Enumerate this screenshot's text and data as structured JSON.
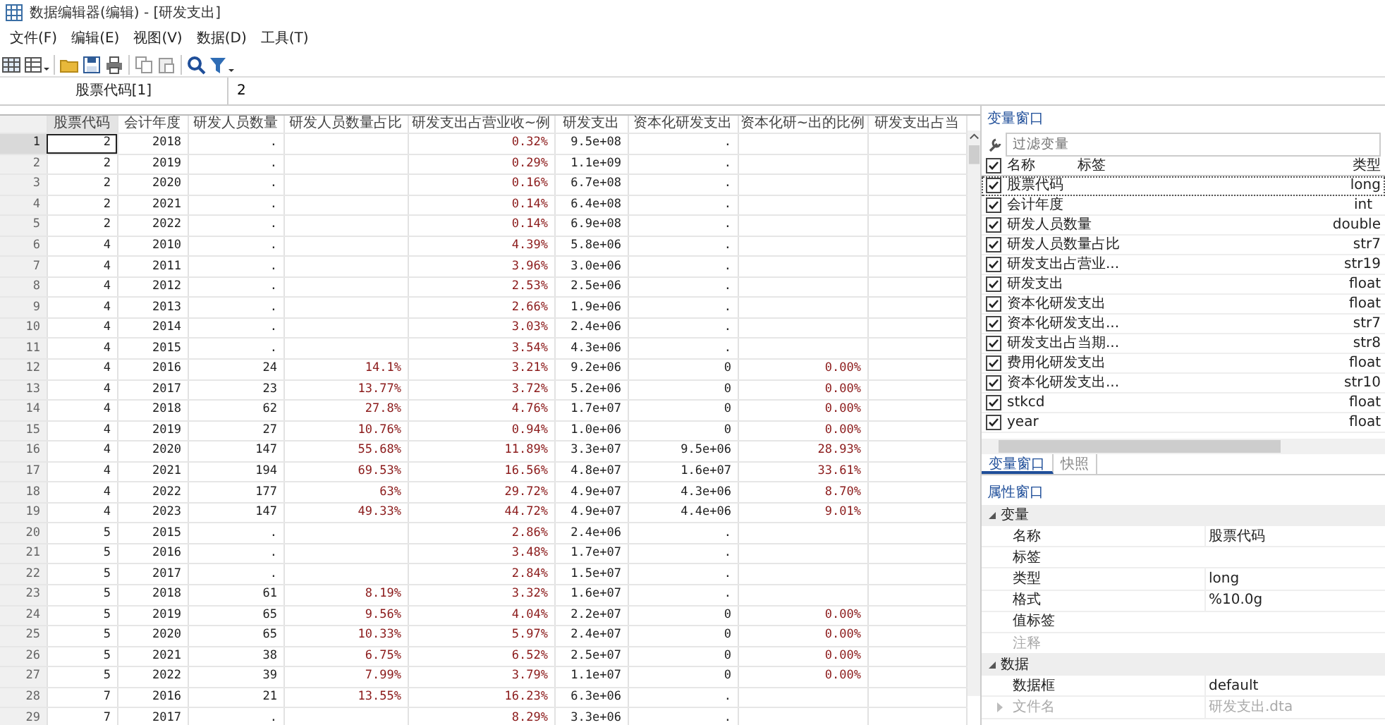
{
  "window": {
    "title": "数据编辑器(编辑) - [研发支出]"
  },
  "menu": [
    "文件(F)",
    "编辑(E)",
    "视图(V)",
    "数据(D)",
    "工具(T)"
  ],
  "cell_bar": {
    "reference": "股票代码[1]",
    "value": "2"
  },
  "table": {
    "columns": [
      {
        "label": "股票代码",
        "kind": "numeric",
        "selected": true
      },
      {
        "label": "会计年度",
        "kind": "numeric",
        "selected": false
      },
      {
        "label": "研发人员数量",
        "kind": "numeric",
        "selected": false
      },
      {
        "label": "研发人员数量占比",
        "kind": "string",
        "selected": false
      },
      {
        "label": "研发支出占营业收~例",
        "kind": "string",
        "selected": false
      },
      {
        "label": "研发支出",
        "kind": "numeric",
        "selected": false
      },
      {
        "label": "资本化研发支出",
        "kind": "numeric",
        "selected": false
      },
      {
        "label": "资本化研~出的比例",
        "kind": "string",
        "selected": false
      },
      {
        "label": "研发支出占当",
        "kind": "string",
        "selected": false
      }
    ],
    "rows": [
      {
        "number": "1",
        "selected": true,
        "cells": [
          "2",
          "2018",
          ".",
          null,
          "0.32%",
          "9.5e+08",
          ".",
          null,
          null
        ]
      },
      {
        "number": "2",
        "selected": false,
        "cells": [
          "2",
          "2019",
          ".",
          null,
          "0.29%",
          "1.1e+09",
          ".",
          null,
          null
        ]
      },
      {
        "number": "3",
        "selected": false,
        "cells": [
          "2",
          "2020",
          ".",
          null,
          "0.16%",
          "6.7e+08",
          ".",
          null,
          null
        ]
      },
      {
        "number": "4",
        "selected": false,
        "cells": [
          "2",
          "2021",
          ".",
          null,
          "0.14%",
          "6.4e+08",
          ".",
          null,
          null
        ]
      },
      {
        "number": "5",
        "selected": false,
        "cells": [
          "2",
          "2022",
          ".",
          null,
          "0.14%",
          "6.9e+08",
          ".",
          null,
          null
        ]
      },
      {
        "number": "6",
        "selected": false,
        "cells": [
          "4",
          "2010",
          ".",
          null,
          "4.39%",
          "5.8e+06",
          ".",
          null,
          null
        ]
      },
      {
        "number": "7",
        "selected": false,
        "cells": [
          "4",
          "2011",
          ".",
          null,
          "3.96%",
          "3.0e+06",
          ".",
          null,
          null
        ]
      },
      {
        "number": "8",
        "selected": false,
        "cells": [
          "4",
          "2012",
          ".",
          null,
          "2.53%",
          "2.5e+06",
          ".",
          null,
          null
        ]
      },
      {
        "number": "9",
        "selected": false,
        "cells": [
          "4",
          "2013",
          ".",
          null,
          "2.66%",
          "1.9e+06",
          ".",
          null,
          null
        ]
      },
      {
        "number": "10",
        "selected": false,
        "cells": [
          "4",
          "2014",
          ".",
          null,
          "3.03%",
          "2.4e+06",
          ".",
          null,
          null
        ]
      },
      {
        "number": "11",
        "selected": false,
        "cells": [
          "4",
          "2015",
          ".",
          null,
          "3.54%",
          "4.3e+06",
          ".",
          null,
          null
        ]
      },
      {
        "number": "12",
        "selected": false,
        "cells": [
          "4",
          "2016",
          "24",
          "14.1%",
          "3.21%",
          "9.2e+06",
          "0",
          "0.00%",
          null
        ]
      },
      {
        "number": "13",
        "selected": false,
        "cells": [
          "4",
          "2017",
          "23",
          "13.77%",
          "3.72%",
          "5.2e+06",
          "0",
          "0.00%",
          null
        ]
      },
      {
        "number": "14",
        "selected": false,
        "cells": [
          "4",
          "2018",
          "62",
          "27.8%",
          "4.76%",
          "1.7e+07",
          "0",
          "0.00%",
          null
        ]
      },
      {
        "number": "15",
        "selected": false,
        "cells": [
          "4",
          "2019",
          "27",
          "10.76%",
          "0.94%",
          "1.0e+06",
          "0",
          "0.00%",
          null
        ]
      },
      {
        "number": "16",
        "selected": false,
        "cells": [
          "4",
          "2020",
          "147",
          "55.68%",
          "11.89%",
          "3.3e+07",
          "9.5e+06",
          "28.93%",
          null
        ]
      },
      {
        "number": "17",
        "selected": false,
        "cells": [
          "4",
          "2021",
          "194",
          "69.53%",
          "16.56%",
          "4.8e+07",
          "1.6e+07",
          "33.61%",
          null
        ]
      },
      {
        "number": "18",
        "selected": false,
        "cells": [
          "4",
          "2022",
          "177",
          "63%",
          "29.72%",
          "4.9e+07",
          "4.3e+06",
          "8.70%",
          null
        ]
      },
      {
        "number": "19",
        "selected": false,
        "cells": [
          "4",
          "2023",
          "147",
          "49.33%",
          "44.72%",
          "4.9e+07",
          "4.4e+06",
          "9.01%",
          null
        ]
      },
      {
        "number": "20",
        "selected": false,
        "cells": [
          "5",
          "2015",
          ".",
          null,
          "2.86%",
          "2.4e+06",
          ".",
          null,
          null
        ]
      },
      {
        "number": "21",
        "selected": false,
        "cells": [
          "5",
          "2016",
          ".",
          null,
          "3.48%",
          "1.7e+07",
          ".",
          null,
          null
        ]
      },
      {
        "number": "22",
        "selected": false,
        "cells": [
          "5",
          "2017",
          ".",
          null,
          "2.84%",
          "1.5e+07",
          ".",
          null,
          null
        ]
      },
      {
        "number": "23",
        "selected": false,
        "cells": [
          "5",
          "2018",
          "61",
          "8.19%",
          "3.32%",
          "1.6e+07",
          ".",
          null,
          null
        ]
      },
      {
        "number": "24",
        "selected": false,
        "cells": [
          "5",
          "2019",
          "65",
          "9.56%",
          "4.04%",
          "2.2e+07",
          "0",
          "0.00%",
          null
        ]
      },
      {
        "number": "25",
        "selected": false,
        "cells": [
          "5",
          "2020",
          "65",
          "10.33%",
          "5.97%",
          "2.4e+07",
          "0",
          "0.00%",
          null
        ]
      },
      {
        "number": "26",
        "selected": false,
        "cells": [
          "5",
          "2021",
          "38",
          "6.75%",
          "6.52%",
          "2.5e+07",
          "0",
          "0.00%",
          null
        ]
      },
      {
        "number": "27",
        "selected": false,
        "cells": [
          "5",
          "2022",
          "39",
          "7.99%",
          "3.79%",
          "1.1e+07",
          "0",
          "0.00%",
          null
        ]
      },
      {
        "number": "28",
        "selected": false,
        "cells": [
          "7",
          "2016",
          "21",
          "13.55%",
          "16.23%",
          "6.3e+06",
          ".",
          null,
          null
        ]
      },
      {
        "number": "29",
        "selected": false,
        "cells": [
          "7",
          "2017",
          ".",
          null,
          "8.29%",
          "3.3e+06",
          ".",
          null,
          null
        ]
      }
    ]
  },
  "variables_window": {
    "title": "变量窗口",
    "filter": {
      "placeholder": "过滤变量"
    },
    "header": {
      "checked": true,
      "name": "名称",
      "label": "标签",
      "type": "类型"
    },
    "variables": [
      {
        "name": "股票代码",
        "type": "long",
        "checked": true,
        "selected": true
      },
      {
        "name": "会计年度",
        "type": "int",
        "checked": true,
        "selected": false
      },
      {
        "name": "研发人员数量",
        "type": "double",
        "checked": true,
        "selected": false
      },
      {
        "name": "研发人员数量占比",
        "type": "str7",
        "checked": true,
        "selected": false
      },
      {
        "name": "研发支出占营业...",
        "type": "str19",
        "checked": true,
        "selected": false
      },
      {
        "name": "研发支出",
        "type": "float",
        "checked": true,
        "selected": false
      },
      {
        "name": "资本化研发支出",
        "type": "float",
        "checked": true,
        "selected": false
      },
      {
        "name": "资本化研发支出...",
        "type": "str7",
        "checked": true,
        "selected": false
      },
      {
        "name": "研发支出占当期...",
        "type": "str8",
        "checked": true,
        "selected": false
      },
      {
        "name": "费用化研发支出",
        "type": "float",
        "checked": true,
        "selected": false
      },
      {
        "name": "资本化研发支出...",
        "type": "str10",
        "checked": true,
        "selected": false
      },
      {
        "name": "stkcd",
        "type": "float",
        "checked": true,
        "selected": false
      },
      {
        "name": "year",
        "type": "float",
        "checked": true,
        "selected": false
      }
    ],
    "tabs": [
      {
        "label": "变量窗口",
        "selected": true
      },
      {
        "label": "快照",
        "selected": false
      }
    ]
  },
  "properties_window": {
    "title": "属性窗口",
    "groups": [
      {
        "label": "变量",
        "expanded": true,
        "items": [
          {
            "name": "名称",
            "value": "股票代码",
            "disabled": false
          },
          {
            "name": "标签",
            "disabled": false
          },
          {
            "name": "类型",
            "value": "long",
            "disabled": false
          },
          {
            "name": "格式",
            "value": "%10.0g",
            "disabled": false
          },
          {
            "name": "值标签",
            "disabled": false
          },
          {
            "name": "注释",
            "disabled": true
          }
        ]
      },
      {
        "label": "数据",
        "expanded": true,
        "items": [
          {
            "name": "数据框",
            "value": "default",
            "disabled": false
          },
          {
            "name": "文件名",
            "value": "研发支出.dta",
            "disabled": true,
            "expandable": true
          }
        ]
      }
    ]
  }
}
